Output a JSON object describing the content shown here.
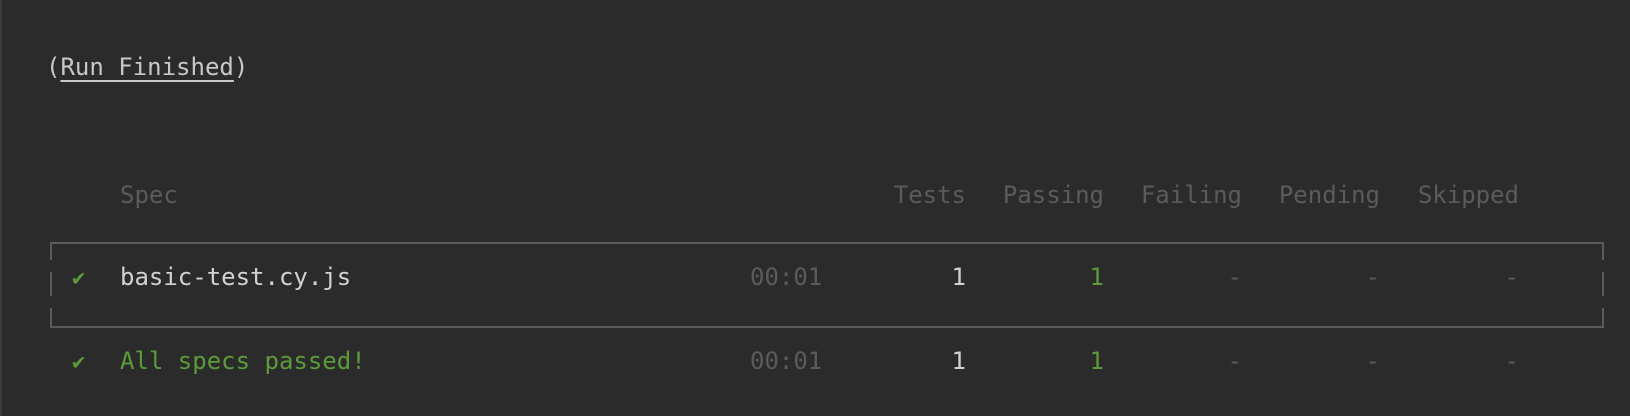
{
  "header": {
    "open_paren": "(",
    "title": "Run Finished",
    "close_paren": ")"
  },
  "table": {
    "columns": {
      "spec": "Spec",
      "tests": "Tests",
      "passing": "Passing",
      "failing": "Failing",
      "pending": "Pending",
      "skipped": "Skipped"
    },
    "rows": [
      {
        "icon": "✔",
        "spec": "basic-test.cy.js",
        "duration": "00:01",
        "tests": "1",
        "passing": "1",
        "failing": "-",
        "pending": "-",
        "skipped": "-"
      }
    ],
    "summary": {
      "icon": "✔",
      "label": "All specs passed!",
      "duration": "00:01",
      "tests": "1",
      "passing": "1",
      "failing": "-",
      "pending": "-",
      "skipped": "-"
    }
  },
  "colors": {
    "background": "#2b2b2b",
    "pass_green": "#5b9b3a",
    "dim_text": "#5b5b5b",
    "text": "#d2d2d2"
  }
}
